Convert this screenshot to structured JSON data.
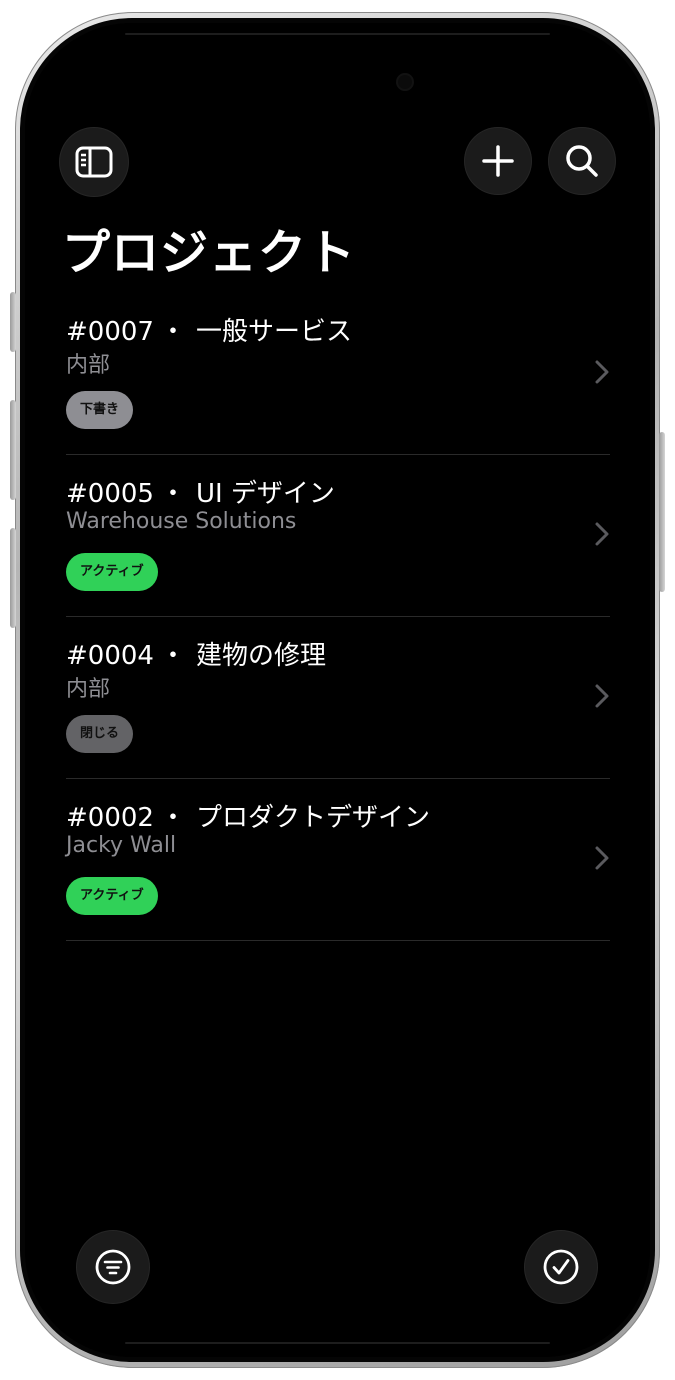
{
  "header": {
    "sidebar_icon": "sidebar-toggle-icon",
    "add_icon": "plus-icon",
    "search_icon": "search-icon",
    "title": "プロジェクト"
  },
  "projects": [
    {
      "number": "#0007",
      "separator": "・",
      "name": "一般サービス",
      "client": "内部",
      "status": "下書き",
      "status_color": "#8e8e93"
    },
    {
      "number": "#0005",
      "separator": "・",
      "name": "UI デザイン",
      "client": "Warehouse Solutions",
      "status": "アクティブ",
      "status_color": "#30d158"
    },
    {
      "number": "#0004",
      "separator": "・",
      "name": "建物の修理",
      "client": "内部",
      "status": "閉じる",
      "status_color": "#636366"
    },
    {
      "number": "#0002",
      "separator": "・",
      "name": "プロダクトデザイン",
      "client": "Jacky Wall",
      "status": "アクティブ",
      "status_color": "#30d158"
    }
  ],
  "footer": {
    "filter_icon": "filter-icon",
    "select_icon": "checkmark-circle-icon"
  },
  "colors": {
    "background": "#000000",
    "text_primary": "#ffffff",
    "text_secondary": "#8e8e93",
    "active": "#30d158",
    "divider": "#2a2a2a"
  }
}
